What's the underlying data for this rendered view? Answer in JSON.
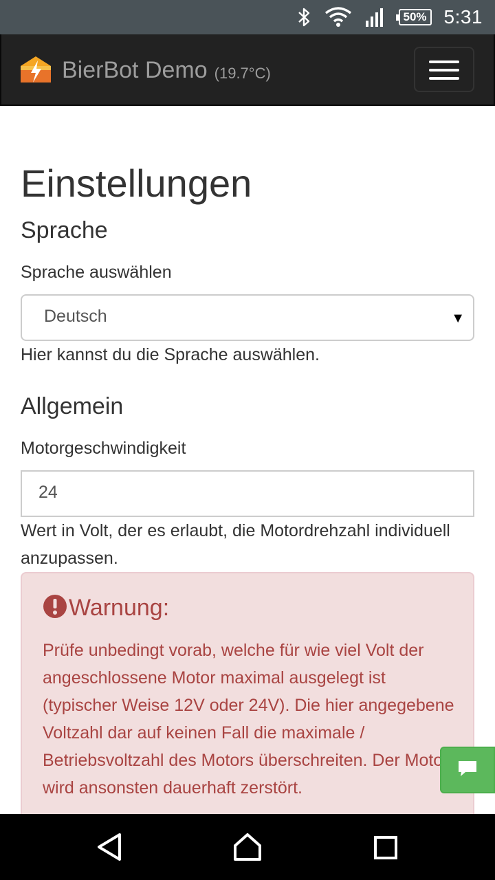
{
  "status_bar": {
    "icons": [
      "bluetooth-icon",
      "wifi-icon",
      "cell-signal-icon"
    ],
    "battery": "50%",
    "time": "5:31"
  },
  "navbar": {
    "brand": "BierBot Demo",
    "temperature": "(19.7°C)",
    "logo_icon": "bierbot-logo-icon",
    "menu_icon": "hamburger-menu-icon"
  },
  "page": {
    "title": "Einstellungen",
    "language": {
      "heading": "Sprache",
      "label": "Sprache auswählen",
      "selected": "Deutsch",
      "help": "Hier kannst du die Sprache auswählen."
    },
    "general": {
      "heading": "Allgemein",
      "motor_label": "Motorgeschwindigkeit",
      "motor_value": "24",
      "motor_help": "Wert in Volt, der es erlaubt, die Motordrehzahl individuell anzupassen."
    },
    "warning": {
      "icon": "exclamation-circle-icon",
      "title": "Warnung:",
      "text": "Prüfe unbedingt vorab, welche für wie viel Volt der angeschlossene Motor maximal ausgelegt ist (typischer Weise 12V oder 24V). Die hier angegebene Voltzahl dar auf keinen Fall die maximale / Betriebsvoltzahl des Motors überschreiten. Der Motor wird ansonsten dauerhaft zerstört."
    }
  },
  "chat_button_icon": "chat-icon",
  "colors": {
    "status_bar": "#4a5358",
    "navbar": "#222222",
    "warning_bg": "#f2dede",
    "warning_text": "#a94442",
    "chat_button": "#5cb85c"
  }
}
